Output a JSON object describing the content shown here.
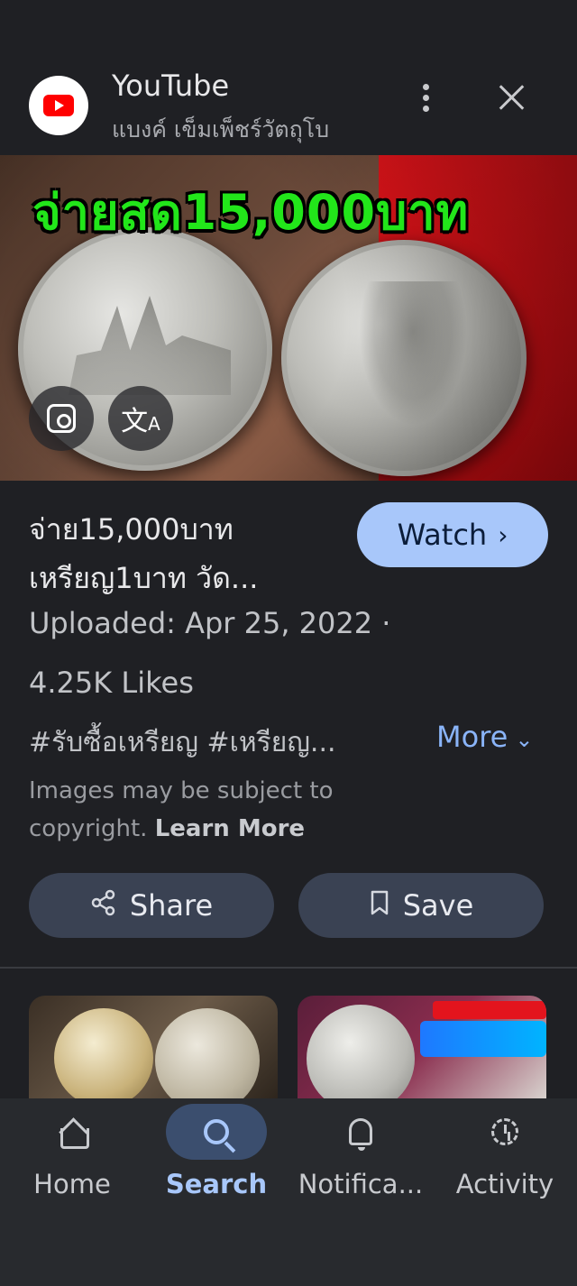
{
  "header": {
    "source_title": "YouTube",
    "source_subtitle": "แบงค์ เข็มเพ็ชร์วัตถุโบ"
  },
  "hero": {
    "caption": "จ่ายสด15,000บาท"
  },
  "result": {
    "title_line1": "จ่าย15,000บาท",
    "title_line2": "เหรียญ1บาท วัด...",
    "watch_label": "Watch",
    "uploaded": "Uploaded: Apr 25, 2022 ·",
    "likes": "4.25K Likes",
    "tags": "#รับซื้อเหรียญ #เหรียญ...",
    "more_label": "More",
    "copyright_text": "Images may be subject to copyright.",
    "learn_more": "Learn More"
  },
  "actions": {
    "share_label": "Share",
    "save_label": "Save"
  },
  "nav": {
    "items": [
      {
        "label": "Home",
        "icon": "home-icon"
      },
      {
        "label": "Search",
        "icon": "search-icon",
        "active": true
      },
      {
        "label": "Notifica...",
        "icon": "bell-icon"
      },
      {
        "label": "Activity",
        "icon": "activity-icon"
      }
    ]
  },
  "colors": {
    "background": "#1f2024",
    "accent": "#a8c7fa",
    "link": "#8ab4f8",
    "caption_green": "#22e61a"
  }
}
